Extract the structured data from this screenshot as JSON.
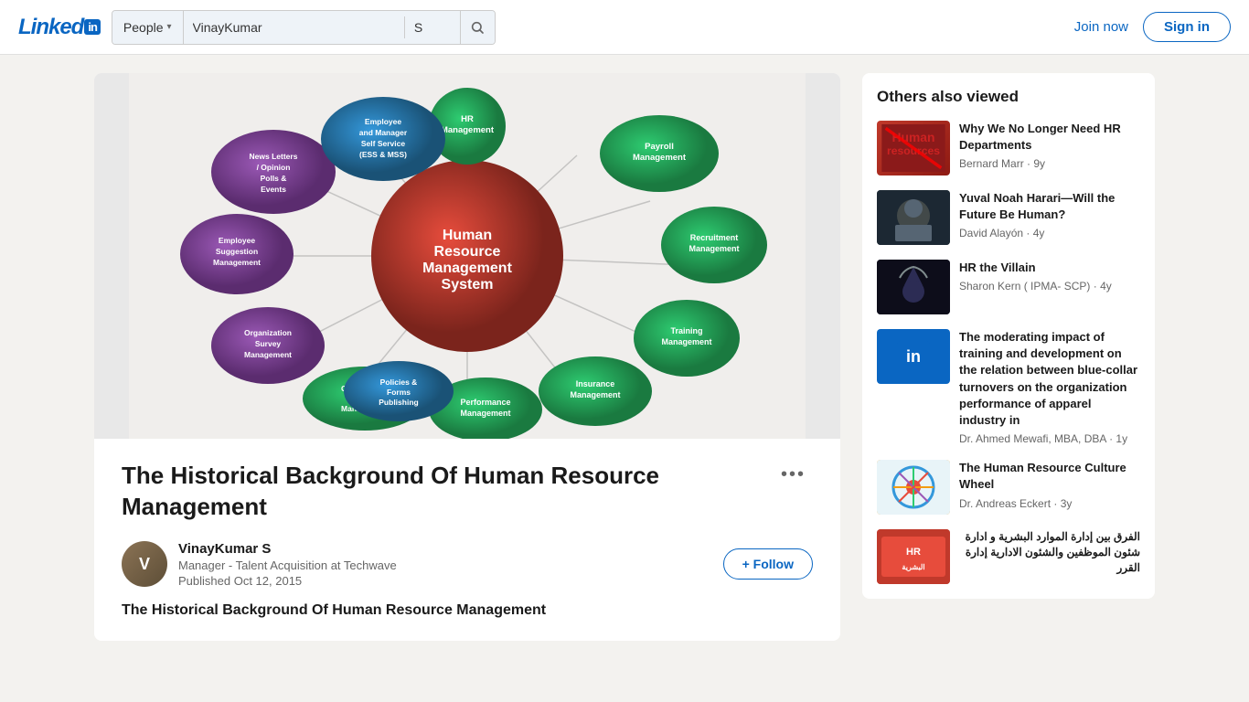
{
  "header": {
    "logo_text": "Linked",
    "logo_in": "in",
    "search_category": "People",
    "search_value": "VinayKumar",
    "search_suffix": "S",
    "join_now": "Join now",
    "sign_in": "Sign in"
  },
  "article": {
    "title": "The Historical Background Of Human Resource Management",
    "body_title": "The Historical Background Of Human Resource Management",
    "more_icon": "•••",
    "author": {
      "name": "VinayKumar S",
      "title": "Manager - Talent Acquisition at Techwave",
      "date": "Published Oct 12, 2015"
    },
    "follow_label": "+ Follow",
    "hrm_center_text": "Human\nResource\nManagement\nSystem"
  },
  "sidebar": {
    "title": "Others also viewed",
    "items": [
      {
        "title": "Why We No Longer Need HR Departments",
        "author": "Bernard Marr",
        "time": "9y",
        "thumb_type": "hr-resources"
      },
      {
        "title": "Yuval Noah Harari—Will the Future Be Human?",
        "author": "David Alayón",
        "time": "4y",
        "thumb_type": "harari"
      },
      {
        "title": "HR the Villain",
        "author": "Sharon Kern ( IPMA- SCP)",
        "time": "4y",
        "thumb_type": "villain"
      },
      {
        "title": "The moderating impact of training and development on the relation between blue-collar turnovers on the organization performance of apparel industry in",
        "author": "Dr. Ahmed Mewafi, MBA, DBA",
        "time": "1y",
        "thumb_type": "linkedin-blue"
      },
      {
        "title": "The Human Resource Culture Wheel",
        "author": "Dr. Andreas Eckert",
        "time": "3y",
        "thumb_type": "wheel"
      },
      {
        "title": "الفرق بين إدارة الموارد البشرية و ادارة شئون الموظفين والشئون الادارية إدارة القرر",
        "author": "",
        "time": "",
        "thumb_type": "arabic"
      }
    ]
  }
}
